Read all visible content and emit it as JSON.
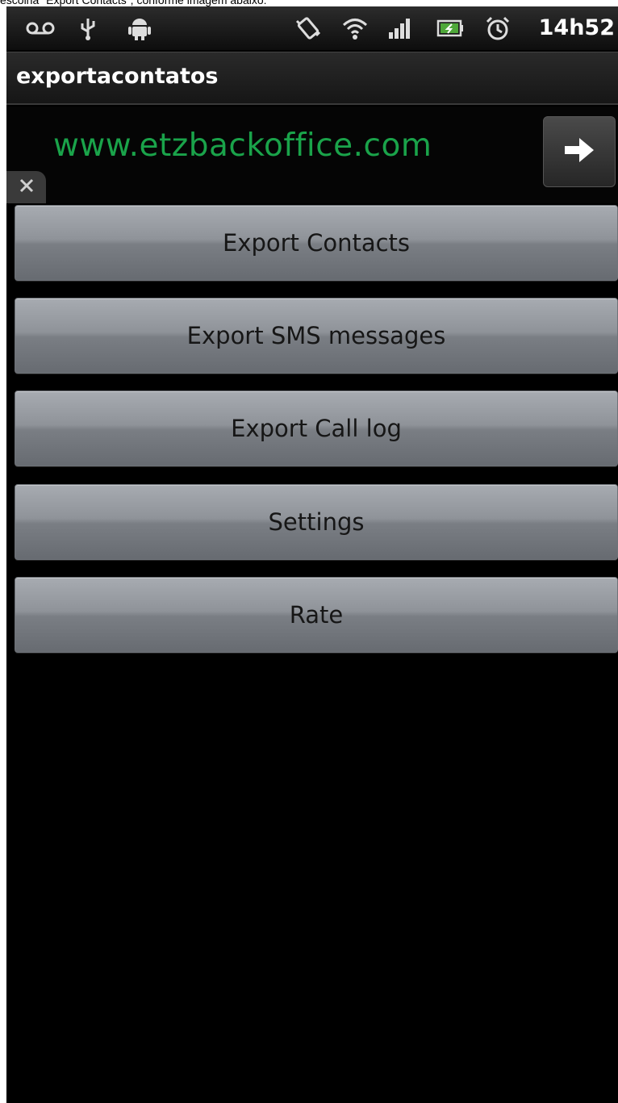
{
  "caption": "escolha \"Export Contacts\", conforme imagem abaixo:",
  "status_bar": {
    "time": "14h52",
    "icons": [
      "voicemail-icon",
      "usb-icon",
      "android-icon",
      "vibrate-icon",
      "wifi-icon",
      "signal-icon",
      "battery-charging-icon",
      "alarm-icon"
    ]
  },
  "app": {
    "title": "exportacontatos"
  },
  "ad_banner": {
    "link_text": "www.etzbackoffice.com",
    "text_color": "#1aa34a"
  },
  "buttons": [
    {
      "label": "Export Contacts"
    },
    {
      "label": "Export SMS messages"
    },
    {
      "label": "Export Call log"
    },
    {
      "label": "Settings"
    },
    {
      "label": "Rate"
    }
  ]
}
